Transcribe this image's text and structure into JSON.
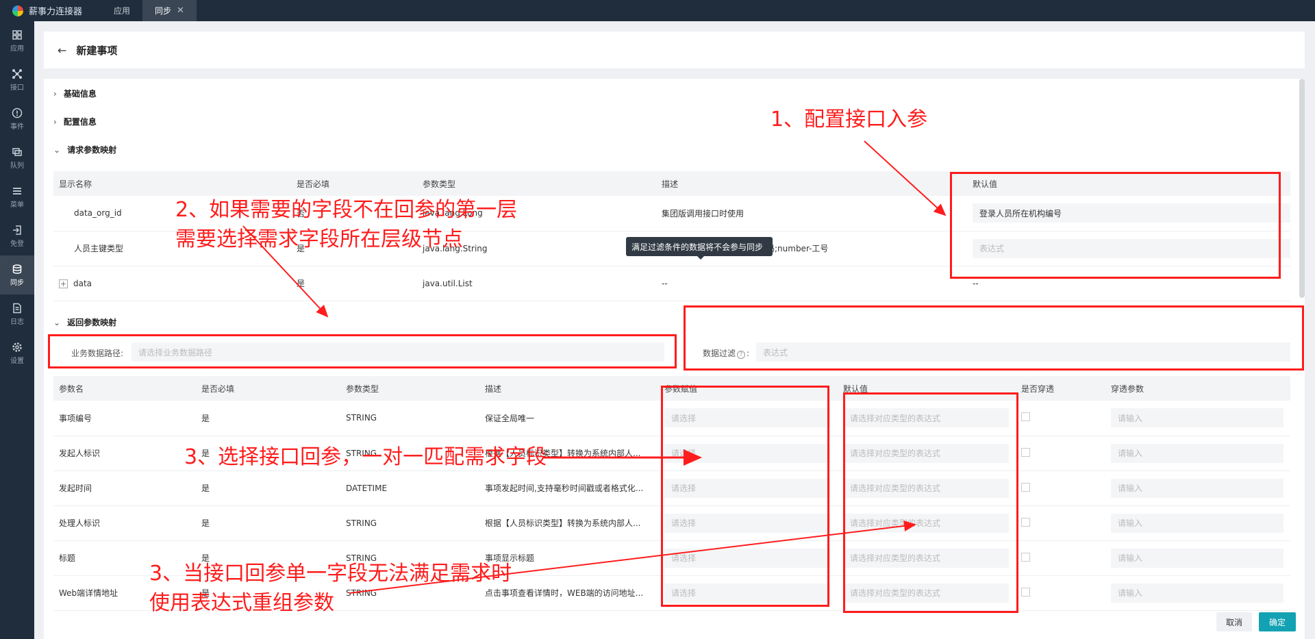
{
  "app": {
    "title": "薪事力连接器"
  },
  "tabs": [
    {
      "label": "应用"
    },
    {
      "label": "同步",
      "close": "✕"
    }
  ],
  "sidebar": {
    "items": [
      {
        "label": "应用",
        "icon": "grid-icon"
      },
      {
        "label": "接口",
        "icon": "network-icon"
      },
      {
        "label": "事件",
        "icon": "alert-icon"
      },
      {
        "label": "队列",
        "icon": "queue-icon"
      },
      {
        "label": "菜单",
        "icon": "menu-icon"
      },
      {
        "label": "免登",
        "icon": "login-icon"
      },
      {
        "label": "同步",
        "icon": "sync-icon"
      },
      {
        "label": "日志",
        "icon": "log-icon"
      },
      {
        "label": "设置",
        "icon": "gear-icon"
      }
    ]
  },
  "header": {
    "back": "←",
    "title": "新建事项"
  },
  "sections": {
    "basic": "基础信息",
    "config": "配置信息",
    "request": "请求参数映射",
    "response": "返回参数映射"
  },
  "request_table": {
    "columns": [
      "显示名称",
      "是否必填",
      "参数类型",
      "描述",
      "默认值"
    ],
    "rows": [
      {
        "name": "data_org_id",
        "required": "否",
        "type": "java.lang.Long",
        "desc": "集团版调用接口时使用",
        "default": "登录人员所在机构编号",
        "default_filled": true
      },
      {
        "name": "人员主键类型",
        "required": "是",
        "type": "java.lang.String",
        "desc": "id-人员id;idNumber-证件号码;number-工号",
        "default": "表达式",
        "default_filled": false
      },
      {
        "name": "data",
        "required": "是",
        "type": "java.util.List",
        "desc": "--",
        "default": "--",
        "expand": "+"
      }
    ]
  },
  "response": {
    "path_label": "业务数据路径:",
    "path_placeholder": "请选择业务数据路径",
    "filter_label": "数据过滤",
    "filter_help": "?",
    "filter_colon": ":",
    "filter_placeholder": "表达式",
    "tooltip": "满足过滤条件的数据将不会参与同步"
  },
  "response_table": {
    "columns": [
      "参数名",
      "是否必填",
      "参数类型",
      "描述",
      "参数赋值",
      "默认值",
      "是否穿透",
      "穿透参数"
    ],
    "rows": [
      {
        "name": "事项编号",
        "required": "是",
        "type": "STRING",
        "desc": "保证全局唯一",
        "assign": "请选择",
        "default": "请选择对应类型的表达式",
        "pass": "请输入"
      },
      {
        "name": "发起人标识",
        "required": "是",
        "type": "STRING",
        "desc": "根据【人员标识类型】转换为系统内部人...",
        "assign": "请选择",
        "default": "请选择对应类型的表达式",
        "pass": "请输入"
      },
      {
        "name": "发起时间",
        "required": "是",
        "type": "DATETIME",
        "desc": "事项发起时间,支持毫秒时间戳或者格式化...",
        "assign": "请选择",
        "default": "请选择对应类型的表达式",
        "pass": "请输入"
      },
      {
        "name": "处理人标识",
        "required": "是",
        "type": "STRING",
        "desc": "根据【人员标识类型】转换为系统内部人...",
        "assign": "请选择",
        "default": "请选择对应类型的表达式",
        "pass": "请输入"
      },
      {
        "name": "标题",
        "required": "是",
        "type": "STRING",
        "desc": "事项显示标题",
        "assign": "请选择",
        "default": "请选择对应类型的表达式",
        "pass": "请输入"
      },
      {
        "name": "Web端详情地址",
        "required": "是",
        "type": "STRING",
        "desc": "点击事项查看详情时，WEB端的访问地址...",
        "assign": "请选择",
        "default": "请选择对应类型的表达式",
        "pass": "请输入"
      }
    ]
  },
  "buttons": {
    "cancel": "取消",
    "ok": "确定"
  },
  "annotations": {
    "a1": "1、配置接口入参",
    "a2_line1": "2、如果需要的字段不在回参的第一层",
    "a2_line2": "需要选择需求字段所在层级节点",
    "a3": "3、选择接口回参，一对一匹配需求字段",
    "a4_line1": "3、当接口回参单一字段无法满足需求时",
    "a4_line2": "使用表达式重组参数",
    "color": "#ff1c1c"
  },
  "colors": {
    "sidebar": "#1f2d3d",
    "primary": "#13a2b3",
    "annotation": "#ff1c1c"
  }
}
